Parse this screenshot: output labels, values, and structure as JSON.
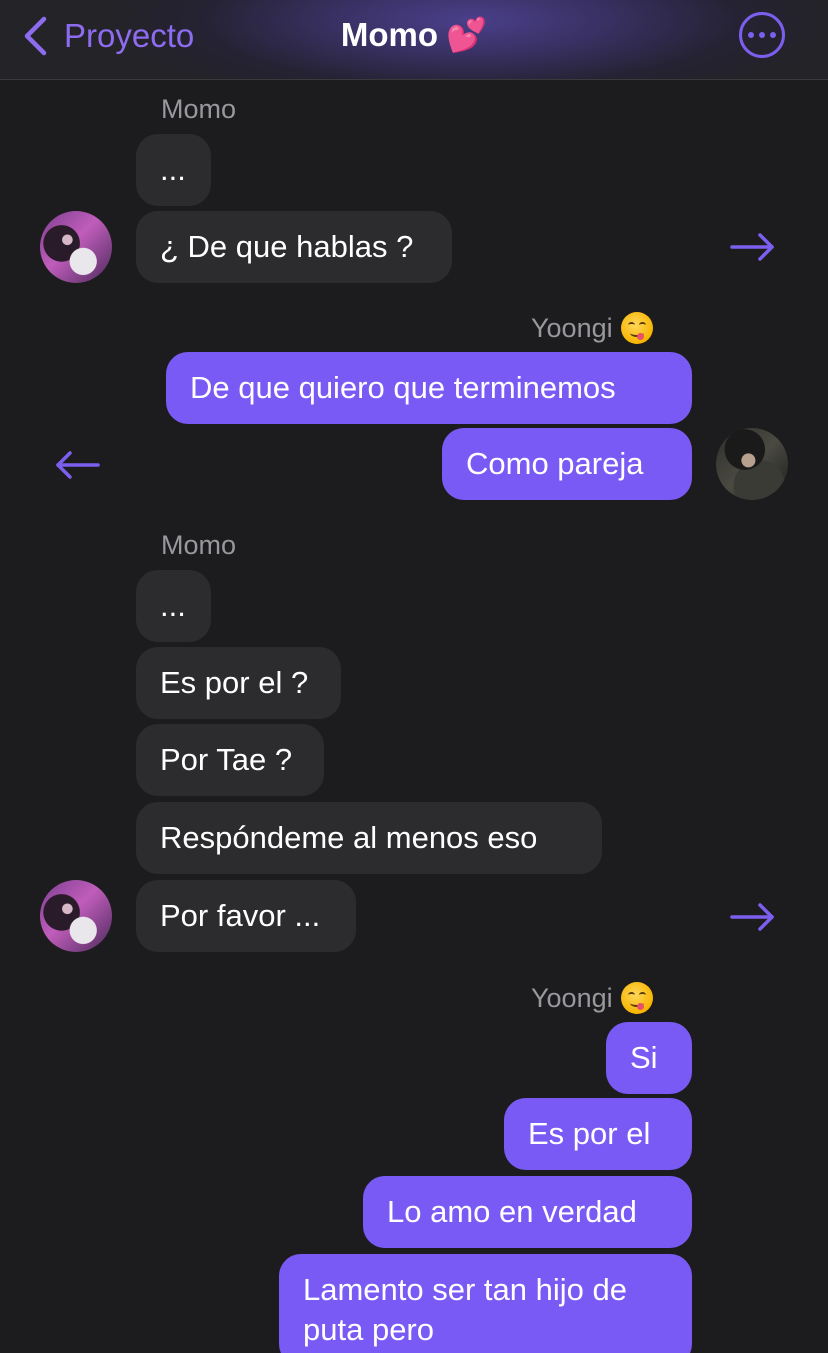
{
  "header": {
    "back_label": "Proyecto",
    "title": "Momo",
    "title_emoji": "💕"
  },
  "chat": {
    "group1": {
      "sender": "Momo",
      "messages": [
        "...",
        "¿ De que hablas ?"
      ]
    },
    "group2": {
      "sender": "Yoongi",
      "sender_emoji": "yum-face-emoji",
      "messages": [
        "De que quiero que terminemos",
        "Como pareja"
      ]
    },
    "group3": {
      "sender": "Momo",
      "messages": [
        "...",
        "Es por el ?",
        "Por Tae ?",
        "Respóndeme al menos eso",
        "Por favor ..."
      ]
    },
    "group4": {
      "sender": "Yoongi",
      "sender_emoji": "yum-face-emoji",
      "messages": [
        "Si",
        "Es por el",
        "Lo amo en verdad",
        "Lamento ser tan hijo de puta pero"
      ]
    }
  },
  "colors": {
    "background": "#1c1c1e",
    "incoming_bubble": "#2c2c2e",
    "outgoing_bubble": "#7a5af5",
    "accent": "#8e6cf0",
    "sender_name": "#98989d"
  }
}
